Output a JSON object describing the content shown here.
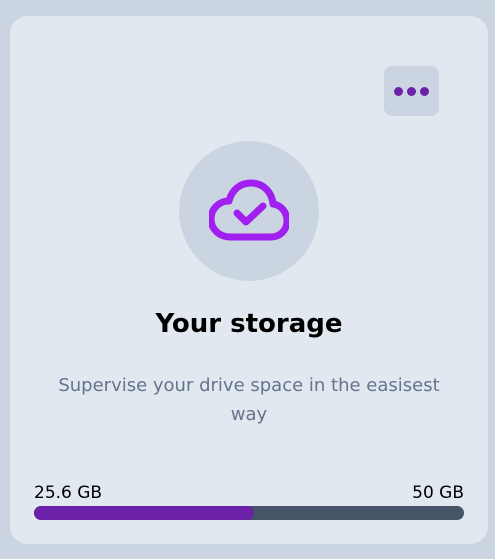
{
  "card": {
    "title": "Your storage",
    "subtitle": "Supervise your drive space in the easisest way",
    "menu_icon": "ellipsis-horizontal-icon",
    "main_icon": "cloud-check-icon"
  },
  "storage": {
    "used_label": "25.6 GB",
    "total_label": "50 GB",
    "used_fraction": 0.512
  },
  "colors": {
    "accent": "#6b21a8",
    "icon": "#a020f0",
    "track": "#475569",
    "card_bg": "#e2e8f0",
    "page_bg": "#cbd5e1"
  }
}
